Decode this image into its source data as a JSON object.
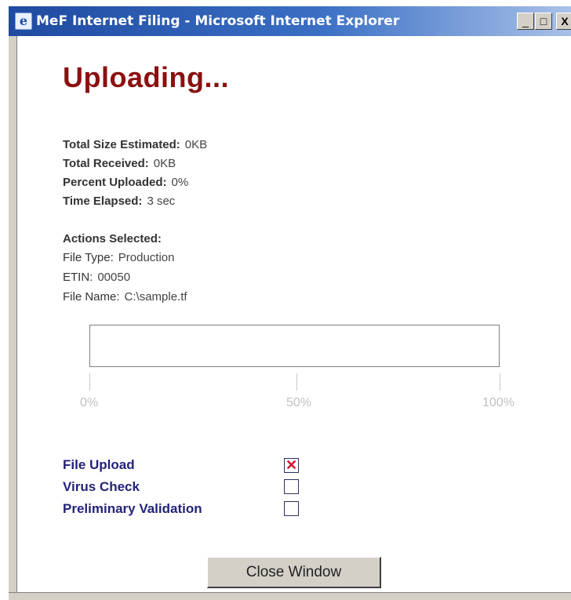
{
  "window": {
    "title": "MeF Internet Filing - Microsoft Internet Explorer",
    "minimize": "_",
    "maximize": "□",
    "close": "X"
  },
  "heading": "Uploading...",
  "stats": {
    "total_size_label": "Total Size Estimated:",
    "total_size_value": "0KB",
    "total_received_label": "Total Received:",
    "total_received_value": "0KB",
    "percent_label": "Percent Uploaded:",
    "percent_value": "0%",
    "time_label": "Time Elapsed:",
    "time_value": "3 sec"
  },
  "actions": {
    "heading": "Actions Selected:",
    "file_type_label": "File Type:",
    "file_type_value": "Production",
    "etin_label": "ETIN:",
    "etin_value": "00050",
    "file_name_label": "File Name:",
    "file_name_value": "C:\\sample.tf"
  },
  "progress": {
    "percent": 0,
    "tick_labels": [
      "0%",
      "50%",
      "100%"
    ]
  },
  "steps": [
    {
      "label": "File Upload",
      "checked": true,
      "mark": "✕"
    },
    {
      "label": "Virus Check",
      "checked": false,
      "mark": ""
    },
    {
      "label": "Preliminary Validation",
      "checked": false,
      "mark": ""
    }
  ],
  "close_button": "Close Window",
  "colors": {
    "heading": "#8b1010",
    "step_label": "#23237a",
    "check_mark": "#d4102a"
  },
  "icons": {
    "app": "ie-icon",
    "minimize": "minimize-icon",
    "maximize": "maximize-icon",
    "close": "close-icon"
  }
}
